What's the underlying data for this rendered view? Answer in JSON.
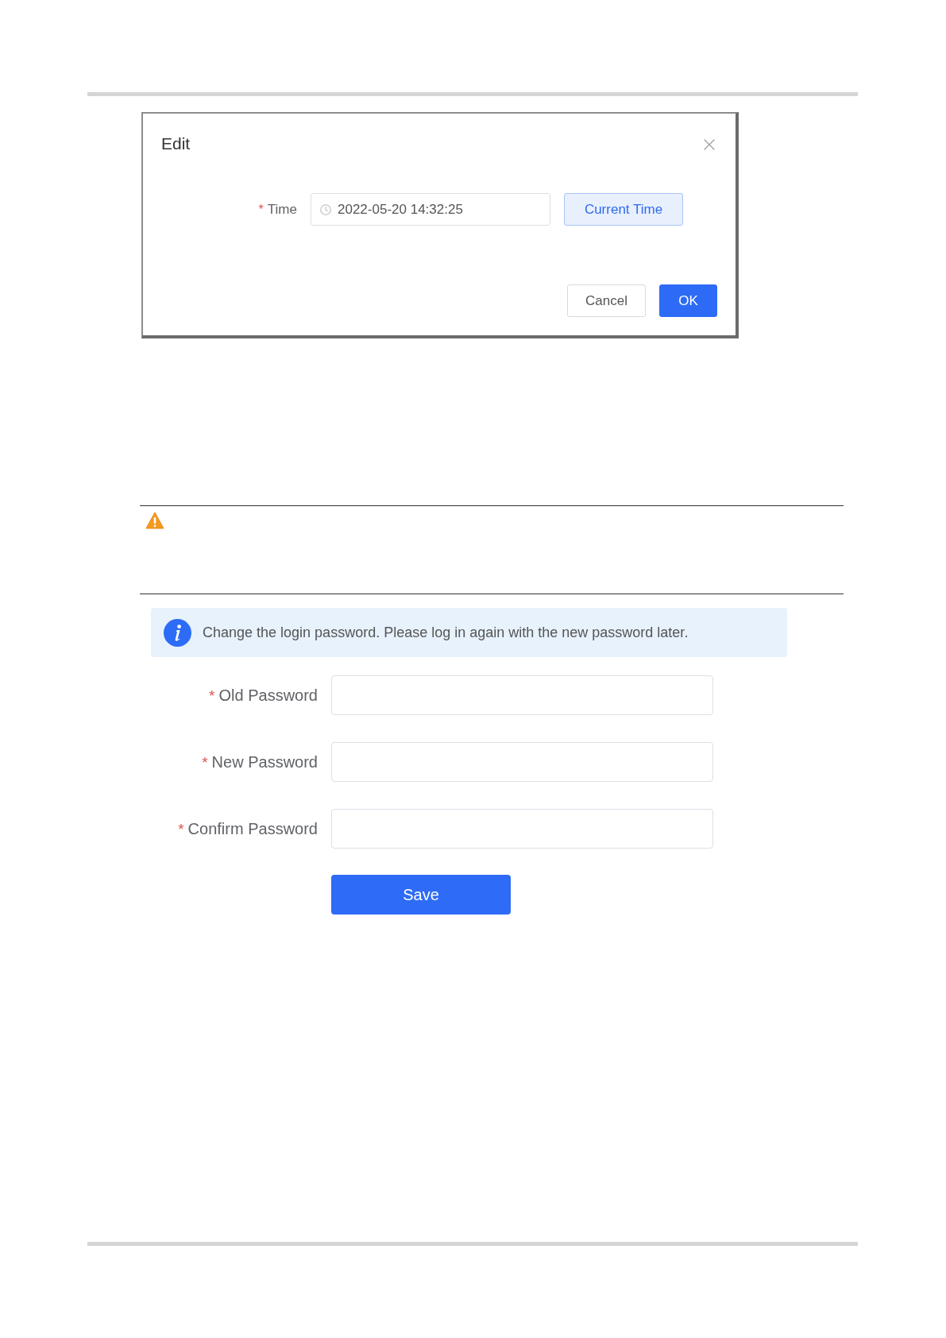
{
  "dialog": {
    "title": "Edit",
    "time_field": {
      "required_mark": "*",
      "label": "Time",
      "value": "2022-05-20 14:32:25"
    },
    "current_time_button": "Current Time",
    "buttons": [
      {
        "kind": "secondary",
        "label": "Cancel"
      },
      {
        "kind": "primary",
        "label": "OK"
      }
    ]
  },
  "password_form": {
    "notice": "Change the login password. Please log in again with the new password later.",
    "fields": [
      {
        "required_mark": "*",
        "label": "Old Password"
      },
      {
        "required_mark": "*",
        "label": "New Password"
      },
      {
        "required_mark": "*",
        "label": "Confirm Password"
      }
    ],
    "save_button": "Save"
  }
}
